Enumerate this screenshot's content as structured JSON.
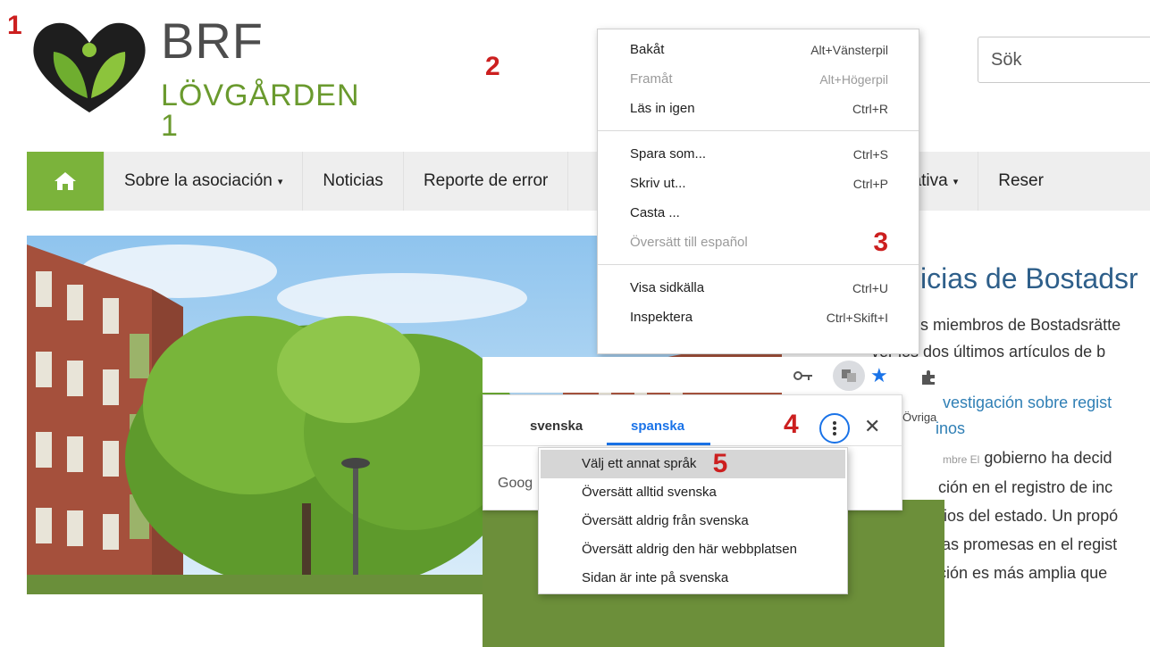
{
  "steps": [
    "1",
    "2",
    "3",
    "4",
    "5"
  ],
  "brand": {
    "title": "BRF",
    "subtitle": "LÖVGÅRDEN 1"
  },
  "search": {
    "placeholder": "Sök"
  },
  "nav": {
    "home_icon": "home-icon",
    "items": [
      "Sobre la asociación",
      "Noticias",
      "Reporte de error",
      "rta informativa",
      "Reser"
    ]
  },
  "news": {
    "title": "icias de Bostadsr",
    "lines": [
      "s miembros de Bostadsrätte",
      "ver los dos últimos artículos de b"
    ],
    "link_lines": [
      "vestigación sobre regist",
      "inos"
    ],
    "date_prefix": "mbre El",
    "body_lines": [
      "gobierno ha decid",
      "ción en el registro de inc",
      "rios del estado. Un propó",
      "las promesas en el regist",
      "ción es más amplia que"
    ]
  },
  "context_menu": {
    "groups": [
      [
        {
          "label": "Bakåt",
          "shortcut": "Alt+Vänsterpil",
          "disabled": false
        },
        {
          "label": "Framåt",
          "shortcut": "Alt+Högerpil",
          "disabled": true
        },
        {
          "label": "Läs in igen",
          "shortcut": "Ctrl+R",
          "disabled": false
        }
      ],
      [
        {
          "label": "Spara som...",
          "shortcut": "Ctrl+S",
          "disabled": false
        },
        {
          "label": "Skriv ut...",
          "shortcut": "Ctrl+P",
          "disabled": false
        },
        {
          "label": "Casta ...",
          "shortcut": "",
          "disabled": false
        },
        {
          "label": "Översätt till español",
          "shortcut": "",
          "disabled": true
        }
      ],
      [
        {
          "label": "Visa sidkälla",
          "shortcut": "Ctrl+U",
          "disabled": false
        },
        {
          "label": "Inspektera",
          "shortcut": "Ctrl+Skift+I",
          "disabled": false
        }
      ]
    ]
  },
  "translate": {
    "tabs": [
      "svenska",
      "spanska"
    ],
    "active_tab": "spanska",
    "google_text": "Goog",
    "other_text": "Övriga",
    "menu": [
      "Välj ett annat språk",
      "Översätt alltid svenska",
      "Översätt aldrig från svenska",
      "Översätt aldrig den här webbplatsen",
      "Sidan är inte på svenska"
    ],
    "highlighted_index": 0
  },
  "colors": {
    "accent_green": "#7bb33b",
    "link_blue": "#1a73e8",
    "step_red": "#cc1f1f",
    "title_blue": "#2e5f8a"
  }
}
